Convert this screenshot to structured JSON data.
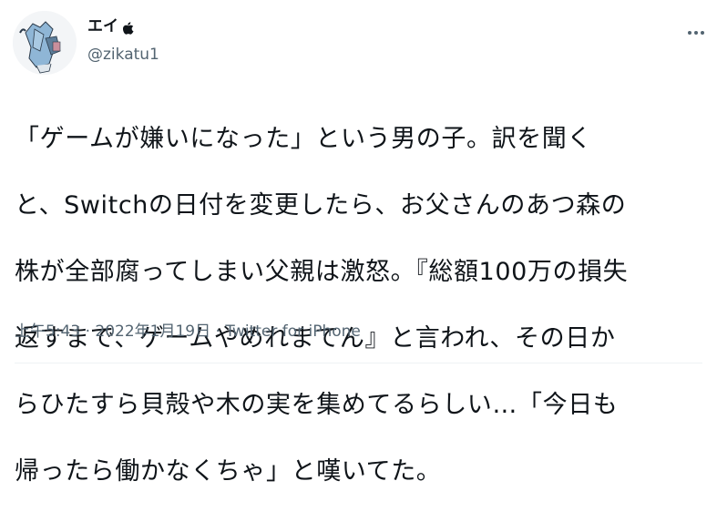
{
  "author": {
    "display_name": "エイ",
    "badge_icon": "apple-icon",
    "handle": "@zikatu1",
    "avatar": "avatar"
  },
  "menu": {
    "icon": "more-icon"
  },
  "tweet": {
    "lines": [
      "「ゲームが嫌いになった」という男の子。訳を聞く",
      "と、Switchの日付を変更したら、お父さんのあつ森の",
      "株が全部腐ってしまい父親は激怒。『総額100万の損失",
      "返すまで、ゲームやめれまてん』と言われ、その日か",
      "らひたすら貝殻や木の実を集めてるらしい…「今日も",
      "帰ったら働かなくちゃ」と嘆いてた。"
    ]
  },
  "meta": {
    "time": "上午5:43",
    "separator": " · ",
    "date": "2022年1月19日",
    "separator2": " · ",
    "source": "Twitter for iPhone"
  },
  "colors": {
    "text": "#0f1419",
    "secondary": "#536471",
    "divider": "#eff3f4"
  }
}
